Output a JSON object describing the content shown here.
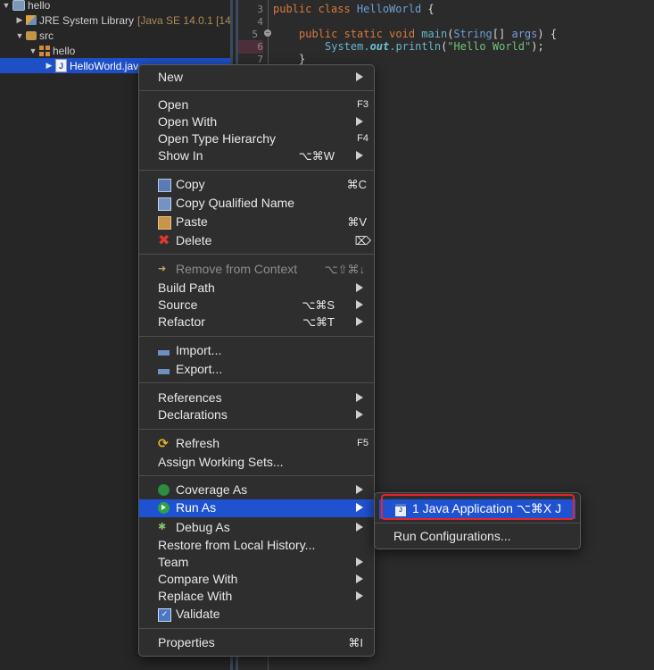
{
  "explorer": {
    "project": "hello",
    "jre_library": "JRE System Library",
    "jre_version": "[Java SE 14.0.1 [14",
    "src_folder": "src",
    "package": "hello",
    "file": "HelloWorld.jav"
  },
  "editor": {
    "line_numbers": [
      "3",
      "4",
      "5",
      "6",
      "7"
    ],
    "lines": {
      "l3_kw": "public class ",
      "l3_cls": "HelloWorld",
      "l3_end": " {",
      "l5_kw": "public static void ",
      "l5_met": "main",
      "l5_p1": "(",
      "l5_typ": "String",
      "l5_p2": "[] ",
      "l5_arg": "args",
      "l5_end": ") {",
      "l6_sys": "System.",
      "l6_out": "out",
      "l6_dot": ".",
      "l6_met": "println",
      "l6_p1": "(",
      "l6_str": "\"Hello World\"",
      "l6_end": ");",
      "l7": "}"
    }
  },
  "context_menu": {
    "new": "New",
    "open": "Open",
    "open_sc": "F3",
    "open_with": "Open With",
    "open_type_hierarchy": "Open Type Hierarchy",
    "open_type_hierarchy_sc": "F4",
    "show_in": "Show In",
    "show_in_sc": "⌥⌘W",
    "copy": "Copy",
    "copy_sc": "⌘C",
    "copy_qualified_name": "Copy Qualified Name",
    "paste": "Paste",
    "paste_sc": "⌘V",
    "delete": "Delete",
    "delete_sc": "⌦",
    "remove_from_context": "Remove from Context",
    "remove_from_context_sc": "⌥⇧⌘↓",
    "build_path": "Build Path",
    "source": "Source",
    "source_sc": "⌥⌘S",
    "refactor": "Refactor",
    "refactor_sc": "⌥⌘T",
    "import": "Import...",
    "export": "Export...",
    "references": "References",
    "declarations": "Declarations",
    "refresh": "Refresh",
    "refresh_sc": "F5",
    "assign_working_sets": "Assign Working Sets...",
    "coverage_as": "Coverage As",
    "run_as": "Run As",
    "debug_as": "Debug As",
    "restore_local_history": "Restore from Local History...",
    "team": "Team",
    "compare_with": "Compare With",
    "replace_with": "Replace With",
    "validate": "Validate",
    "properties": "Properties",
    "properties_sc": "⌘I"
  },
  "submenu": {
    "java_application": "1 Java Application ⌥⌘X J",
    "run_configurations": "Run Configurations..."
  },
  "colors": {
    "selection": "#1f52d1",
    "highlight_ring": "#e5252a",
    "keyword": "#d67a3c",
    "string": "#72c27a"
  }
}
